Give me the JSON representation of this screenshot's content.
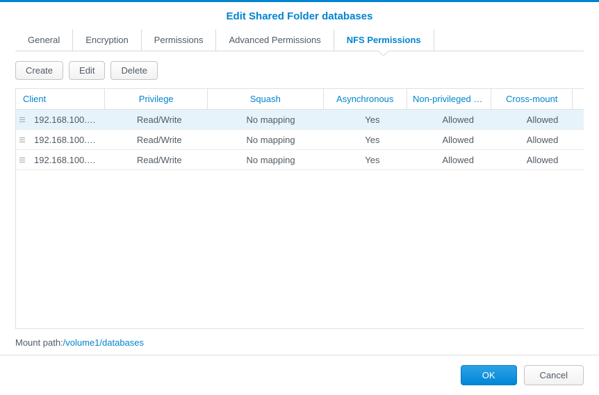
{
  "dialog": {
    "title": "Edit Shared Folder databases"
  },
  "tabs": [
    {
      "label": "General"
    },
    {
      "label": "Encryption"
    },
    {
      "label": "Permissions"
    },
    {
      "label": "Advanced Permissions"
    },
    {
      "label": "NFS Permissions"
    }
  ],
  "toolbar": {
    "create": "Create",
    "edit": "Edit",
    "delete": "Delete"
  },
  "columns": {
    "client": "Client",
    "privilege": "Privilege",
    "squash": "Squash",
    "async": "Asynchronous",
    "nonpriv": "Non-privileged p…",
    "cross": "Cross-mount"
  },
  "rows": [
    {
      "client": "192.168.100.…",
      "privilege": "Read/Write",
      "squash": "No mapping",
      "async": "Yes",
      "nonpriv": "Allowed",
      "cross": "Allowed"
    },
    {
      "client": "192.168.100.…",
      "privilege": "Read/Write",
      "squash": "No mapping",
      "async": "Yes",
      "nonpriv": "Allowed",
      "cross": "Allowed"
    },
    {
      "client": "192.168.100.…",
      "privilege": "Read/Write",
      "squash": "No mapping",
      "async": "Yes",
      "nonpriv": "Allowed",
      "cross": "Allowed"
    }
  ],
  "mount": {
    "label": "Mount path:",
    "path": "/volume1/databases"
  },
  "footer": {
    "ok": "OK",
    "cancel": "Cancel"
  }
}
